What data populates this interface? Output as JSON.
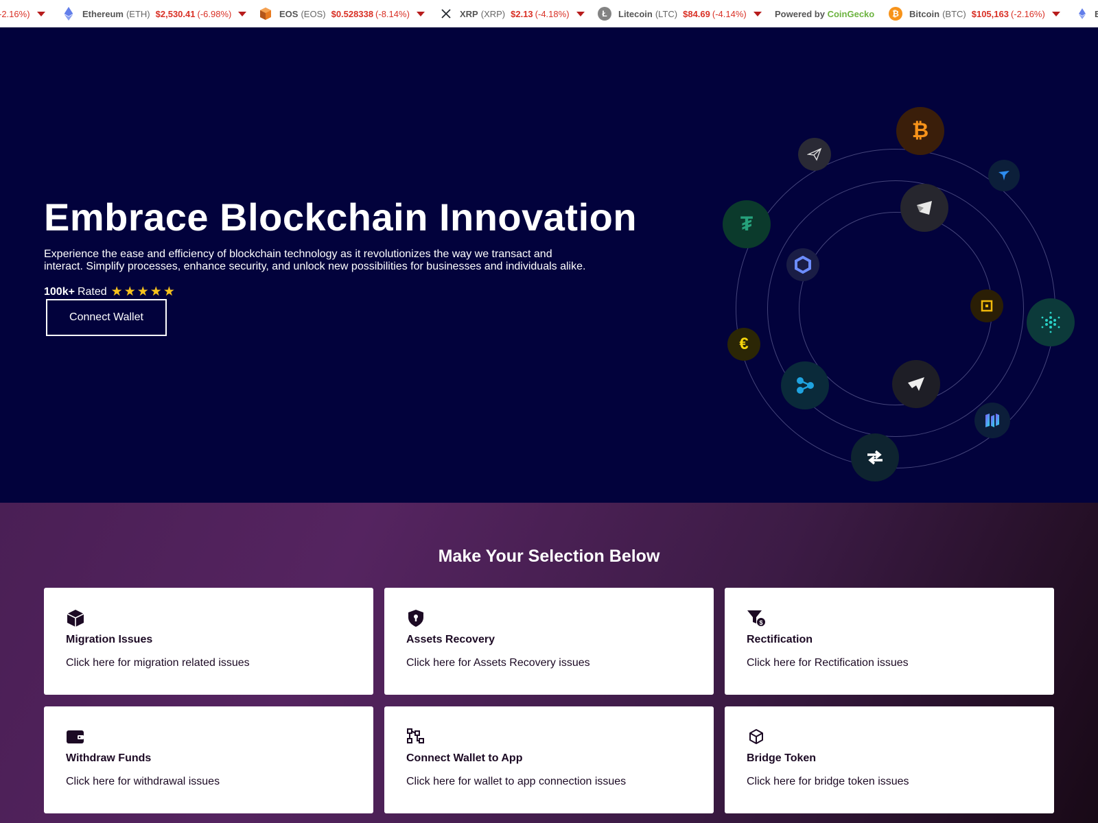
{
  "ticker": {
    "items": [
      {
        "name": "",
        "symbol": "",
        "price": "",
        "change": "-2.16%)",
        "icon": "caret"
      },
      {
        "name": "Ethereum",
        "symbol": "(ETH)",
        "price": "$2,530.41",
        "change": "(-6.98%)",
        "icon": "ethereum-icon",
        "color": "#627eea"
      },
      {
        "name": "EOS",
        "symbol": "(EOS)",
        "price": "$0.528338",
        "change": "(-8.14%)",
        "icon": "eos-icon",
        "color": "#e87a1f"
      },
      {
        "name": "XRP",
        "symbol": "(XRP)",
        "price": "$2.13",
        "change": "(-4.18%)",
        "icon": "xrp-icon",
        "color": "#23292f"
      },
      {
        "name": "Litecoin",
        "symbol": "(LTC)",
        "price": "$84.69",
        "change": "(-4.14%)",
        "icon": "litecoin-icon",
        "color": "#838383"
      },
      {
        "name": "Bitcoin",
        "symbol": "(BTC)",
        "price": "$105,163",
        "change": "(-2.16%)",
        "icon": "bitcoin-icon",
        "color": "#f7931a"
      }
    ],
    "powered_prefix": "Powered by ",
    "powered_brand": "CoinGecko",
    "trailing": "E"
  },
  "hero": {
    "title": "Embrace Blockchain Innovation",
    "description": "Experience the ease and efficiency of blockchain technology as it revolutionizes the way we transact and interact. Simplify processes, enhance security, and unlock new possibilities for businesses and individuals alike.",
    "rating_count": "100k+",
    "rating_label": "Rated",
    "stars": 5,
    "button_label": "Connect Wallet"
  },
  "selection": {
    "title": "Make Your Selection Below",
    "cards": [
      {
        "title": "Migration Issues",
        "text": "Click here for migration related issues",
        "icon": "cube-icon"
      },
      {
        "title": "Assets Recovery",
        "text": "Click here for Assets Recovery issues",
        "icon": "shield-keyhole-icon"
      },
      {
        "title": "Rectification",
        "text": "Click here for Rectification issues",
        "icon": "funnel-dollar-icon"
      },
      {
        "title": "Withdraw Funds",
        "text": "Click here for withdrawal issues",
        "icon": "wallet-icon"
      },
      {
        "title": "Connect Wallet to App",
        "text": "Click here for wallet to app connection issues",
        "icon": "network-nodes-icon"
      },
      {
        "title": "Bridge Token",
        "text": "Click here for bridge token issues",
        "icon": "box-outline-icon"
      }
    ]
  },
  "colors": {
    "hero_bg": "#02023c",
    "price_down": "#d93025",
    "coingecko": "#6cb33f",
    "star": "#f6c21c"
  }
}
